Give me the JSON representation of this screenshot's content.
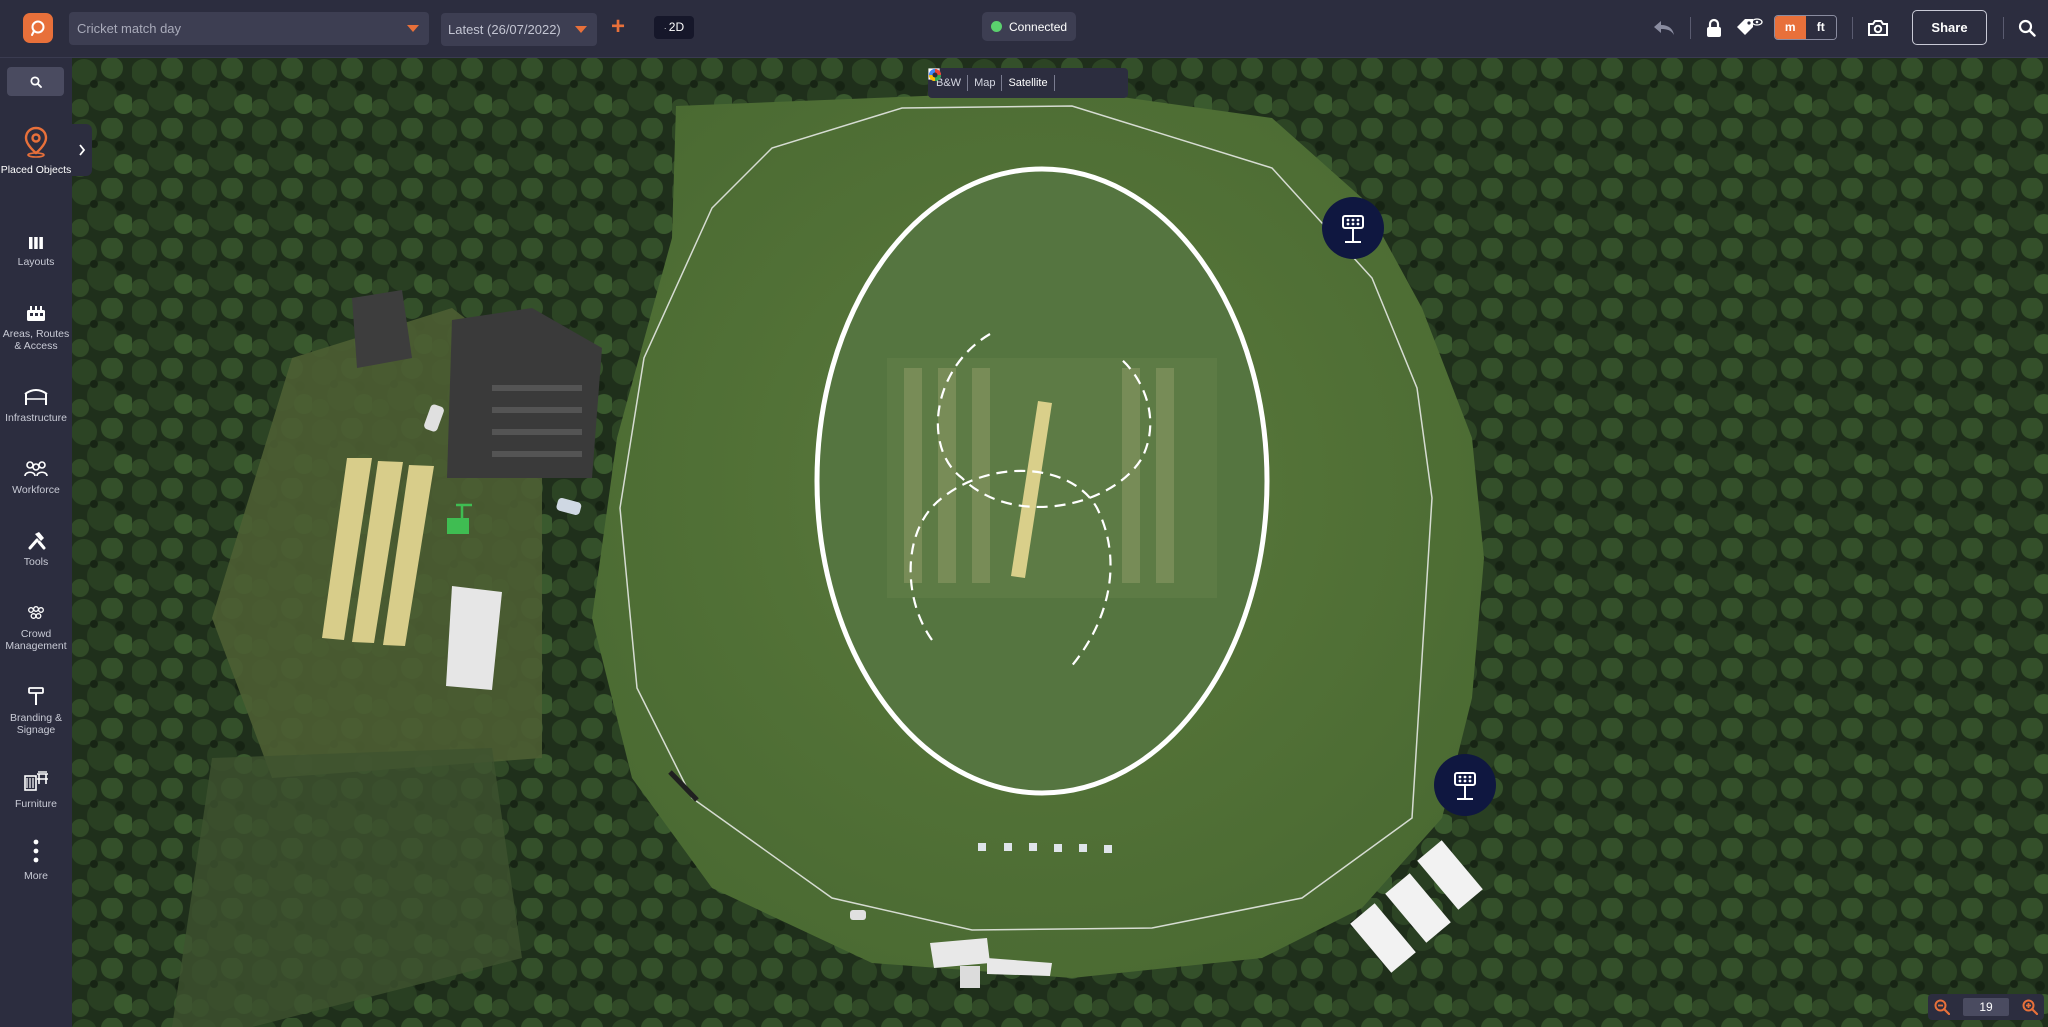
{
  "topbar": {
    "project_name": "Cricket match day",
    "version": "Latest (26/07/2022)",
    "view_mode": "2D",
    "connection_status": "Connected",
    "units": {
      "metric": "m",
      "imperial": "ft"
    },
    "share_label": "Share"
  },
  "sidebar": {
    "items": [
      {
        "label": "Placed Objects",
        "icon": "map-pin-icon"
      },
      {
        "label": "Layouts",
        "icon": "layouts-icon"
      },
      {
        "label": "Areas, Routes & Access",
        "icon": "areas-icon"
      },
      {
        "label": "Infrastructure",
        "icon": "infrastructure-icon"
      },
      {
        "label": "Workforce",
        "icon": "workforce-icon"
      },
      {
        "label": "Tools",
        "icon": "tools-icon"
      },
      {
        "label": "Crowd Management",
        "icon": "crowd-icon"
      },
      {
        "label": "Branding & Signage",
        "icon": "signage-icon"
      },
      {
        "label": "Furniture",
        "icon": "furniture-icon"
      },
      {
        "label": "More",
        "icon": "more-icon"
      }
    ]
  },
  "map": {
    "layers": {
      "bw": "B&W",
      "map": "Map",
      "satellite": "Satellite"
    },
    "zoom_level": "19"
  },
  "colors": {
    "accent": "#e8703a",
    "chrome": "#2c2d3f",
    "connected": "#5bd06e",
    "floodlight": "#0f1740"
  }
}
